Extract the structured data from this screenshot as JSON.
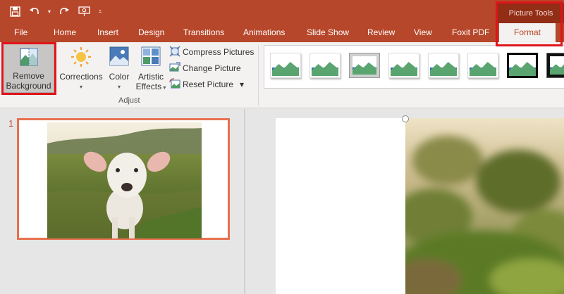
{
  "quick_access": {
    "save_icon": "save-icon",
    "undo_icon": "undo-icon",
    "redo_icon": "redo-icon",
    "presentation_icon": "start-from-beginning-icon",
    "customize_icon": "customize-qat-icon"
  },
  "contextual_tab_group": {
    "label": "Picture Tools"
  },
  "tabs": [
    {
      "label": "File"
    },
    {
      "label": "Home"
    },
    {
      "label": "Insert"
    },
    {
      "label": "Design"
    },
    {
      "label": "Transitions"
    },
    {
      "label": "Animations"
    },
    {
      "label": "Slide Show"
    },
    {
      "label": "Review"
    },
    {
      "label": "View"
    },
    {
      "label": "Foxit PDF"
    },
    {
      "label": "Format",
      "active": true
    }
  ],
  "ribbon": {
    "remove_background": {
      "line1": "Remove",
      "line2": "Background"
    },
    "corrections": {
      "label": "Corrections"
    },
    "color": {
      "label": "Color"
    },
    "artistic_effects": {
      "line1": "Artistic",
      "line2": "Effects"
    },
    "compress_pictures": "Compress Pictures",
    "change_picture": "Change Picture",
    "reset_picture": "Reset Picture",
    "adjust_group_label": "Adjust"
  },
  "picture_styles_count": 8,
  "slides": [
    {
      "number": "1"
    }
  ],
  "colors": {
    "accent": "#b7472a",
    "context": "#922d16",
    "highlight": "#e0141a",
    "thumb_border": "#e8704f"
  }
}
